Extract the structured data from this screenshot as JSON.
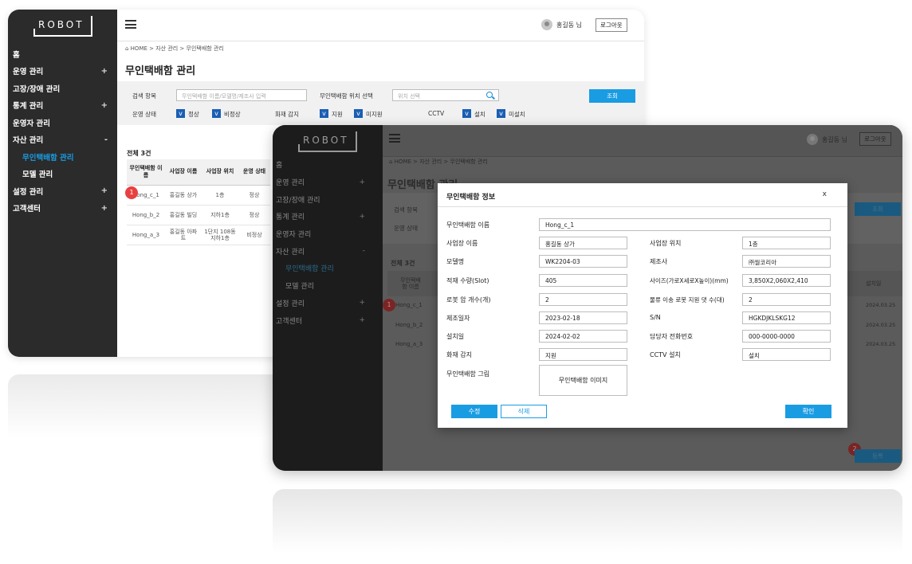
{
  "brand": "ROBOT",
  "user": {
    "name": "홍길동 님",
    "logout": "로그아웃"
  },
  "menu": [
    {
      "label": "홈",
      "toggle": ""
    },
    {
      "label": "운영 관리",
      "toggle": "+"
    },
    {
      "label": "고장/장애 관리",
      "toggle": ""
    },
    {
      "label": "통계 관리",
      "toggle": "+"
    },
    {
      "label": "운영자 관리",
      "toggle": ""
    },
    {
      "label": "자산 관리",
      "toggle": "-"
    },
    {
      "label": "무인택배함 관리",
      "toggle": ""
    },
    {
      "label": "모델 관리",
      "toggle": ""
    },
    {
      "label": "설정 관리",
      "toggle": "+"
    },
    {
      "label": "고객센터",
      "toggle": "+"
    }
  ],
  "breadcrumb": "⌂ HOME > 자산 관리 > 무인택배함 관리",
  "page_title": "무인택배함 관리",
  "search": {
    "item_label": "검색 항목",
    "item_placeholder": "무인택배함 이름/모델명/제조사 입력",
    "location_label": "무인택배함 위치 선택",
    "location_placeholder": "위치 선택",
    "search_button": "조회",
    "status_label": "운영 상태",
    "status_normal": "정상",
    "status_abnormal": "비정상",
    "fire_label": "화재 감지",
    "fire_support": "지원",
    "fire_unsupported": "미지원",
    "cctv_label": "CCTV",
    "cctv_installed": "설치",
    "cctv_not_installed": "미설치",
    "check_mark": "v"
  },
  "list": {
    "count": "전체 3건",
    "headers": [
      "무인택배함 이름",
      "사업장 이름",
      "사업장 위치",
      "운영 상태"
    ],
    "rows": [
      [
        "Hong_c_1",
        "홍길동 상가",
        "1층",
        "정상"
      ],
      [
        "Hong_b_2",
        "홍길동 빌딩",
        "지하1층",
        "정상"
      ],
      [
        "Hong_a_3",
        "홍길동 아파트",
        "1단지 108동 지하1층",
        "비정상"
      ]
    ],
    "install_header": "설치일",
    "install_dates": [
      "2024.03.25",
      "2024.03.25",
      "2024.03.25"
    ]
  },
  "badges": {
    "one": "1",
    "two": "2"
  },
  "register_button": "등록",
  "modal": {
    "title": "무인택배함 정보",
    "close": "x",
    "fields": {
      "name_label": "무인택배함 이름",
      "name": "Hong_c_1",
      "site_label": "사업장 이름",
      "site": "홍길동 상가",
      "site_loc_label": "사업장 위치",
      "site_loc": "1층",
      "model_label": "모델명",
      "model": "WK2204-03",
      "maker_label": "제조사",
      "maker": "㈜월코리아",
      "capacity_label": "적재 수량(Slot)",
      "capacity": "405",
      "size_label": "사이즈(가로X세로X높이)(mm)",
      "size": "3,850X2,060X2,410",
      "arms_label": "로봇 암 개수(개)",
      "arms": "2",
      "logistics_label": "물류 이송 로봇 지원 댓 수(대)",
      "logistics": "2",
      "mfg_label": "제조일자",
      "mfg": "2023-02-18",
      "sn_label": "S/N",
      "sn": "HGKDJKLSKG12",
      "install_label": "설치일",
      "install": "2024-02-02",
      "phone_label": "담당자 전화번호",
      "phone": "000-0000-0000",
      "fire_label": "화재 감지",
      "fire": "지원",
      "cctv_label": "CCTV 설치",
      "cctv": "설치",
      "image_label": "무인택배함 그림",
      "image": "무인택배함 이미지"
    },
    "edit": "수정",
    "delete": "삭제",
    "confirm": "확인"
  },
  "colors": {
    "accent": "#1a9ce3",
    "sidebar": "#2b2b2b",
    "badge": "#e84040"
  }
}
